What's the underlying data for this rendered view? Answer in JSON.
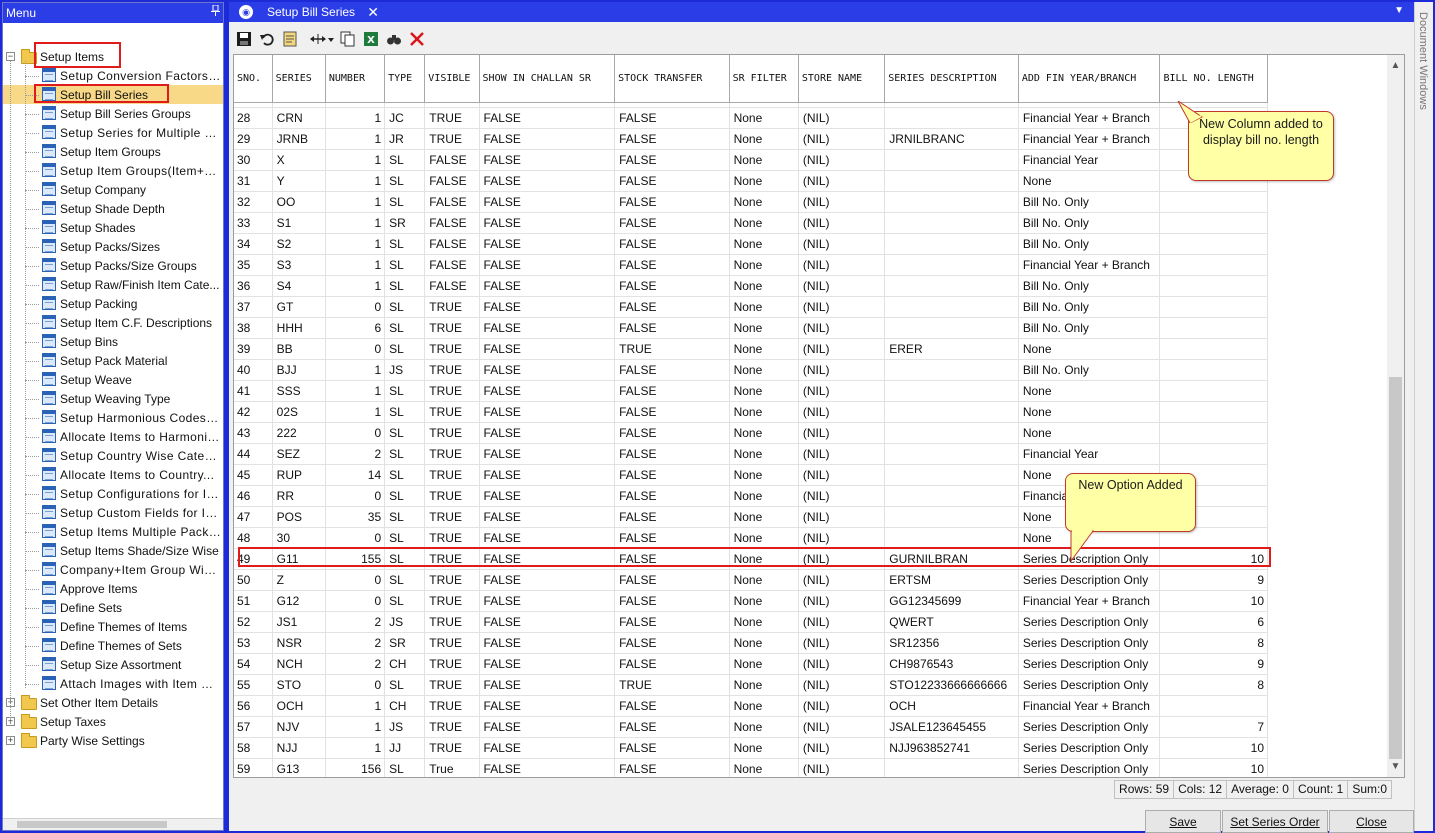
{
  "menu": {
    "title": "Menu",
    "pin_icon": "pin-icon",
    "items": [
      {
        "label": "Setup Items",
        "type": "folder",
        "level": 0,
        "expanded": true
      },
      {
        "label": "Setup Conversion Factors C...",
        "type": "form",
        "level": 1,
        "spaced": true
      },
      {
        "label": "Setup Bill Series",
        "type": "form",
        "level": 1,
        "selected": true
      },
      {
        "label": "Setup Bill Series Groups",
        "type": "form",
        "level": 1
      },
      {
        "label": "Setup Series for Multiple Br...",
        "type": "form",
        "level": 1,
        "spaced": true
      },
      {
        "label": "Setup Item Groups",
        "type": "form",
        "level": 1
      },
      {
        "label": "Setup Item Groups(Item+Si...",
        "type": "form",
        "level": 1,
        "spaced": true
      },
      {
        "label": "Setup Company",
        "type": "form",
        "level": 1
      },
      {
        "label": "Setup Shade Depth",
        "type": "form",
        "level": 1
      },
      {
        "label": "Setup Shades",
        "type": "form",
        "level": 1
      },
      {
        "label": "Setup Packs/Sizes",
        "type": "form",
        "level": 1
      },
      {
        "label": "Setup Packs/Size Groups",
        "type": "form",
        "level": 1
      },
      {
        "label": "Setup Raw/Finish Item Cate...",
        "type": "form",
        "level": 1
      },
      {
        "label": "Setup Packing",
        "type": "form",
        "level": 1
      },
      {
        "label": "Setup Item C.F. Descriptions",
        "type": "form",
        "level": 1
      },
      {
        "label": "Setup Bins",
        "type": "form",
        "level": 1
      },
      {
        "label": "Setup Pack Material",
        "type": "form",
        "level": 1
      },
      {
        "label": "Setup Weave",
        "type": "form",
        "level": 1
      },
      {
        "label": "Setup Weaving Type",
        "type": "form",
        "level": 1
      },
      {
        "label": "Setup Harmonious Codes/...",
        "type": "form",
        "level": 1,
        "spaced": true
      },
      {
        "label": "Allocate Items to Harmonio...",
        "type": "form",
        "level": 1,
        "spaced": true
      },
      {
        "label": "Setup Country Wise Catego...",
        "type": "form",
        "level": 1,
        "spaced": true
      },
      {
        "label": "Allocate Items to Country...",
        "type": "form",
        "level": 1,
        "spaced": true
      },
      {
        "label": "Setup Configurations for Ite...",
        "type": "form",
        "level": 1,
        "spaced": true
      },
      {
        "label": "Setup Custom Fields for Ite...",
        "type": "form",
        "level": 1,
        "spaced": true
      },
      {
        "label": "Setup Items Multiple Packs/...",
        "type": "form",
        "level": 1,
        "spaced": true
      },
      {
        "label": "Setup Items Shade/Size Wise",
        "type": "form",
        "level": 1
      },
      {
        "label": "Company+Item Group Wis...",
        "type": "form",
        "level": 1,
        "spaced": true
      },
      {
        "label": "Approve Items",
        "type": "form",
        "level": 1
      },
      {
        "label": "Define Sets",
        "type": "form",
        "level": 1
      },
      {
        "label": "Define Themes of Items",
        "type": "form",
        "level": 1
      },
      {
        "label": "Define Themes of Sets",
        "type": "form",
        "level": 1
      },
      {
        "label": "Setup Size Assortment",
        "type": "form",
        "level": 1
      },
      {
        "label": "Attach Images with Item M...",
        "type": "form",
        "level": 1,
        "spaced": true
      },
      {
        "label": "Set Other Item Details",
        "type": "folder",
        "level": 0,
        "expanded": false
      },
      {
        "label": "Setup Taxes",
        "type": "folder",
        "level": 0,
        "expanded": false
      },
      {
        "label": "Party Wise Settings",
        "type": "folder",
        "level": 0,
        "expanded": false
      }
    ]
  },
  "tab": {
    "title": "Setup Bill Series",
    "close": "✕",
    "app_icon": "app-logo-icon"
  },
  "toolbar": {
    "icons": [
      "save-icon",
      "undo-icon",
      "print-preview-icon",
      "column-width-icon",
      "copy-icon",
      "excel-export-icon",
      "find-icon",
      "delete-icon"
    ]
  },
  "grid": {
    "columns": [
      "SNO.",
      "SERIES",
      "NUMBER",
      "TYPE",
      "VISIBLE",
      "SHOW IN CHALLAN SR",
      "STOCK TRANSFER",
      "SR FILTER",
      "STORE NAME",
      "SERIES DESCRIPTION",
      "ADD FIN YEAR/BRANCH",
      "BILL NO. LENGTH"
    ],
    "rows": [
      [
        "28",
        "CRN",
        "1",
        "JC",
        "TRUE",
        "FALSE",
        "FALSE",
        "None",
        "(NIL)",
        "",
        "Financial Year + Branch",
        ""
      ],
      [
        "29",
        "JRNB",
        "1",
        "JR",
        "TRUE",
        "FALSE",
        "FALSE",
        "None",
        "(NIL)",
        "JRNILBRANC",
        "Financial Year + Branch",
        ""
      ],
      [
        "30",
        "X",
        "1",
        "SL",
        "FALSE",
        "FALSE",
        "FALSE",
        "None",
        "(NIL)",
        "",
        "Financial Year",
        ""
      ],
      [
        "31",
        "Y",
        "1",
        "SL",
        "FALSE",
        "FALSE",
        "FALSE",
        "None",
        "(NIL)",
        "",
        "None",
        ""
      ],
      [
        "32",
        "OO",
        "1",
        "SL",
        "FALSE",
        "FALSE",
        "FALSE",
        "None",
        "(NIL)",
        "",
        "Bill No. Only",
        ""
      ],
      [
        "33",
        "S1",
        "1",
        "SR",
        "FALSE",
        "FALSE",
        "FALSE",
        "None",
        "(NIL)",
        "",
        "Bill No. Only",
        ""
      ],
      [
        "34",
        "S2",
        "1",
        "SL",
        "FALSE",
        "FALSE",
        "FALSE",
        "None",
        "(NIL)",
        "",
        "Bill No. Only",
        ""
      ],
      [
        "35",
        "S3",
        "1",
        "SL",
        "FALSE",
        "FALSE",
        "FALSE",
        "None",
        "(NIL)",
        "",
        "Financial Year + Branch",
        ""
      ],
      [
        "36",
        "S4",
        "1",
        "SL",
        "FALSE",
        "FALSE",
        "FALSE",
        "None",
        "(NIL)",
        "",
        "Bill No. Only",
        ""
      ],
      [
        "37",
        "GT",
        "0",
        "SL",
        "TRUE",
        "FALSE",
        "FALSE",
        "None",
        "(NIL)",
        "",
        "Bill No. Only",
        ""
      ],
      [
        "38",
        "HHH",
        "6",
        "SL",
        "TRUE",
        "FALSE",
        "FALSE",
        "None",
        "(NIL)",
        "",
        "Bill No. Only",
        ""
      ],
      [
        "39",
        "BB",
        "0",
        "SL",
        "TRUE",
        "FALSE",
        "TRUE",
        "None",
        "(NIL)",
        "ERER",
        "None",
        ""
      ],
      [
        "40",
        "BJJ",
        "1",
        "JS",
        "TRUE",
        "FALSE",
        "FALSE",
        "None",
        "(NIL)",
        "",
        "Bill No. Only",
        ""
      ],
      [
        "41",
        "SSS",
        "1",
        "SL",
        "TRUE",
        "FALSE",
        "FALSE",
        "None",
        "(NIL)",
        "",
        "None",
        ""
      ],
      [
        "42",
        "02S",
        "1",
        "SL",
        "TRUE",
        "FALSE",
        "FALSE",
        "None",
        "(NIL)",
        "",
        "None",
        ""
      ],
      [
        "43",
        "222",
        "0",
        "SL",
        "TRUE",
        "FALSE",
        "FALSE",
        "None",
        "(NIL)",
        "",
        "None",
        ""
      ],
      [
        "44",
        "SEZ",
        "2",
        "SL",
        "TRUE",
        "FALSE",
        "FALSE",
        "None",
        "(NIL)",
        "",
        "Financial Year",
        ""
      ],
      [
        "45",
        "RUP",
        "14",
        "SL",
        "TRUE",
        "FALSE",
        "FALSE",
        "None",
        "(NIL)",
        "",
        "None",
        ""
      ],
      [
        "46",
        "RR",
        "0",
        "SL",
        "TRUE",
        "FALSE",
        "FALSE",
        "None",
        "(NIL)",
        "",
        "Financia",
        ""
      ],
      [
        "47",
        "POS",
        "35",
        "SL",
        "TRUE",
        "FALSE",
        "FALSE",
        "None",
        "(NIL)",
        "",
        "None",
        ""
      ],
      [
        "48",
        "30",
        "0",
        "SL",
        "TRUE",
        "FALSE",
        "FALSE",
        "None",
        "(NIL)",
        "",
        "None",
        ""
      ],
      [
        "49",
        "G11",
        "155",
        "SL",
        "TRUE",
        "FALSE",
        "FALSE",
        "None",
        "(NIL)",
        "GURNILBRAN",
        "Series Description Only",
        "10"
      ],
      [
        "50",
        "Z",
        "0",
        "SL",
        "TRUE",
        "FALSE",
        "FALSE",
        "None",
        "(NIL)",
        "ERTSM",
        "Series Description Only",
        "9"
      ],
      [
        "51",
        "G12",
        "0",
        "SL",
        "TRUE",
        "FALSE",
        "FALSE",
        "None",
        "(NIL)",
        "GG12345699",
        "Financial Year + Branch",
        "10"
      ],
      [
        "52",
        "JS1",
        "2",
        "JS",
        "TRUE",
        "FALSE",
        "FALSE",
        "None",
        "(NIL)",
        "QWERT",
        "Series Description Only",
        "6"
      ],
      [
        "53",
        "NSR",
        "2",
        "SR",
        "TRUE",
        "FALSE",
        "FALSE",
        "None",
        "(NIL)",
        "SR12356",
        "Series Description Only",
        "8"
      ],
      [
        "54",
        "NCH",
        "2",
        "CH",
        "TRUE",
        "FALSE",
        "FALSE",
        "None",
        "(NIL)",
        "CH9876543",
        "Series Description Only",
        "9"
      ],
      [
        "55",
        "STO",
        "0",
        "SL",
        "TRUE",
        "FALSE",
        "TRUE",
        "None",
        "(NIL)",
        "STO12233666666666",
        "Series Description Only",
        "8"
      ],
      [
        "56",
        "OCH",
        "1",
        "CH",
        "TRUE",
        "FALSE",
        "FALSE",
        "None",
        "(NIL)",
        "OCH",
        "Financial Year + Branch",
        ""
      ],
      [
        "57",
        "NJV",
        "1",
        "JS",
        "TRUE",
        "FALSE",
        "FALSE",
        "None",
        "(NIL)",
        "JSALE123645455",
        "Series Description Only",
        "7"
      ],
      [
        "58",
        "NJJ",
        "1",
        "JJ",
        "TRUE",
        "FALSE",
        "FALSE",
        "None",
        "(NIL)",
        "NJJ963852741",
        "Series Description Only",
        "10"
      ],
      [
        "59",
        "G13",
        "156",
        "SL",
        "True",
        "FALSE",
        "FALSE",
        "None",
        "(NIL)",
        "",
        "Series Description Only",
        "10"
      ]
    ]
  },
  "callouts": {
    "new_column": "New Column added to display bill no. length",
    "new_option": "New Option Added"
  },
  "status": {
    "rows": "Rows: 59",
    "cols": "Cols: 12",
    "average": "Average: 0",
    "count": "Count: 1",
    "sum": "Sum:0"
  },
  "buttons": {
    "save": "Save",
    "set_series_order": "Set Series Order",
    "close": "Close"
  },
  "side_strip": {
    "label": "Document Windows"
  },
  "colors": {
    "title_bar": "#2b3de6",
    "selection": "#f8d987",
    "highlight_box": "#e01b1b",
    "callout_fill": "#ffffa6"
  }
}
